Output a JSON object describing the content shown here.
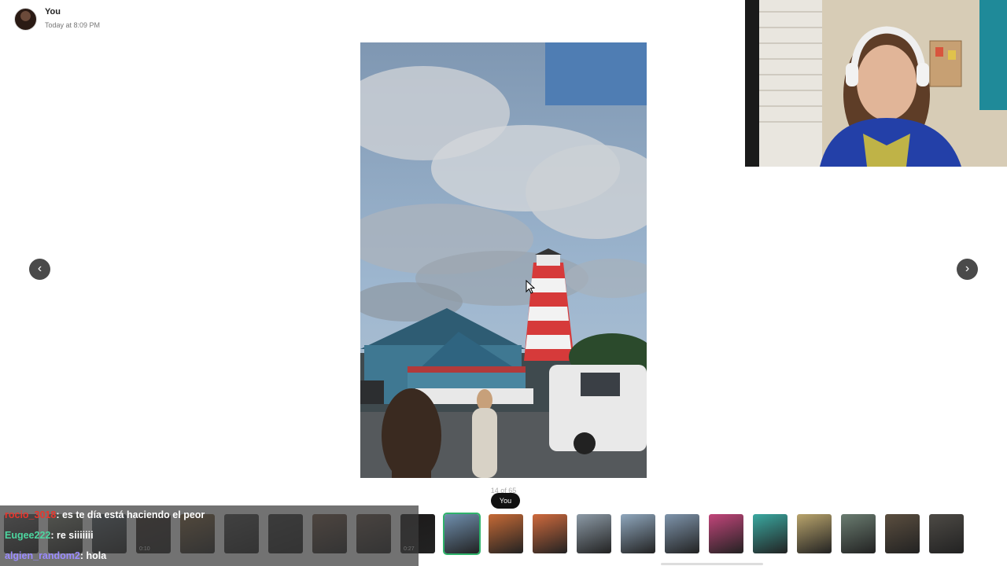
{
  "header": {
    "author": "You",
    "timestamp": "Today at 8:09 PM"
  },
  "navigation": {
    "prev_glyph": "‹",
    "next_glyph": "›"
  },
  "viewer": {
    "counter": "14 of 65",
    "tooltip": "You"
  },
  "thumbnails": [
    {
      "color": "#6e6e6e",
      "duration": ""
    },
    {
      "color": "#8a8f7e",
      "duration": ""
    },
    {
      "color": "#5d6a73",
      "duration": ""
    },
    {
      "color": "#3b2e27",
      "duration": "0:10"
    },
    {
      "color": "#8b6a3f",
      "duration": ""
    },
    {
      "color": "#4e4e4e",
      "duration": ""
    },
    {
      "color": "#3c3c3c",
      "duration": ""
    },
    {
      "color": "#7a5c4a",
      "duration": ""
    },
    {
      "color": "#6c584c",
      "duration": ""
    },
    {
      "color": "#1c1a1a",
      "duration": "0:27"
    },
    {
      "color": "#6f8fae",
      "duration": "",
      "selected": true
    },
    {
      "color": "#c66a36",
      "duration": ""
    },
    {
      "color": "#cf6a3d",
      "duration": ""
    },
    {
      "color": "#8c9aa6",
      "duration": ""
    },
    {
      "color": "#8fa7bd",
      "duration": ""
    },
    {
      "color": "#7e94ab",
      "duration": ""
    },
    {
      "color": "#c2457a",
      "duration": ""
    },
    {
      "color": "#3aa8a0",
      "duration": ""
    },
    {
      "color": "#b9a46c",
      "duration": ""
    },
    {
      "color": "#6a7c70",
      "duration": ""
    },
    {
      "color": "#5b4e3f",
      "duration": ""
    },
    {
      "color": "#4d4a45",
      "duration": ""
    }
  ],
  "chat": [
    {
      "user": "rocio_3018",
      "user_color": "#e8362d",
      "message": ": es te día está haciendo el peor"
    },
    {
      "user": "Eugee222",
      "user_color": "#4dd6a0",
      "message": ": re siiiiiii"
    },
    {
      "user": "algien_random2",
      "user_color": "#9b8cff",
      "message": ": hola"
    }
  ],
  "colors": {
    "accent_selected": "#2fb36b",
    "nav_button": "#4a4a4a"
  }
}
